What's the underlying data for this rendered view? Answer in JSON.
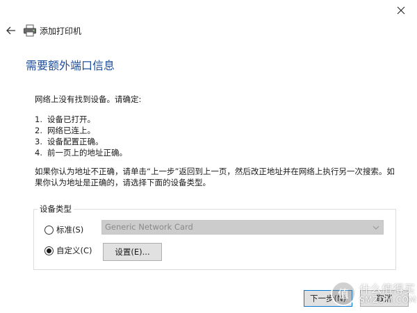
{
  "window": {
    "title": "添加打印机",
    "close_glyph": "✕"
  },
  "page": {
    "heading": "需要额外端口信息",
    "intro": "网络上没有找到设备。请确定:",
    "checklist": [
      {
        "num": "1.",
        "text": "设备已打开。"
      },
      {
        "num": "2.",
        "text": "网络已连上。"
      },
      {
        "num": "3.",
        "text": "设备配置正确。"
      },
      {
        "num": "4.",
        "text": "前一页上的地址正确。"
      }
    ],
    "instructions_line1": "如果你认为地址不正确，请单击“上一步”返回到上一页，然后改正地址并在网络上执行另一次搜索。如",
    "instructions_line2": "果你认为地址是正确的，请选择下面的设备类型。"
  },
  "device_type": {
    "group_label": "设备类型",
    "standard_label": "标准(S)",
    "standard_selected": false,
    "standard_value": "Generic Network Card",
    "custom_label": "自定义(C)",
    "custom_selected": true,
    "settings_button": "设置(E)..."
  },
  "footer": {
    "next_button": "下一步(N)",
    "cancel_button": "取消"
  },
  "watermark": {
    "text_zh": "什么值得买",
    "text_en": "SMZDM.COM"
  },
  "icons": {
    "back": "back-arrow-icon",
    "printer": "printer-icon",
    "close": "close-icon",
    "dropdown": "chevron-down-icon"
  },
  "colors": {
    "heading": "#1f4e9b",
    "button_face": "#e1e1e1",
    "default_button_border": "#0078d7",
    "disabled_select": "#cccccc"
  }
}
